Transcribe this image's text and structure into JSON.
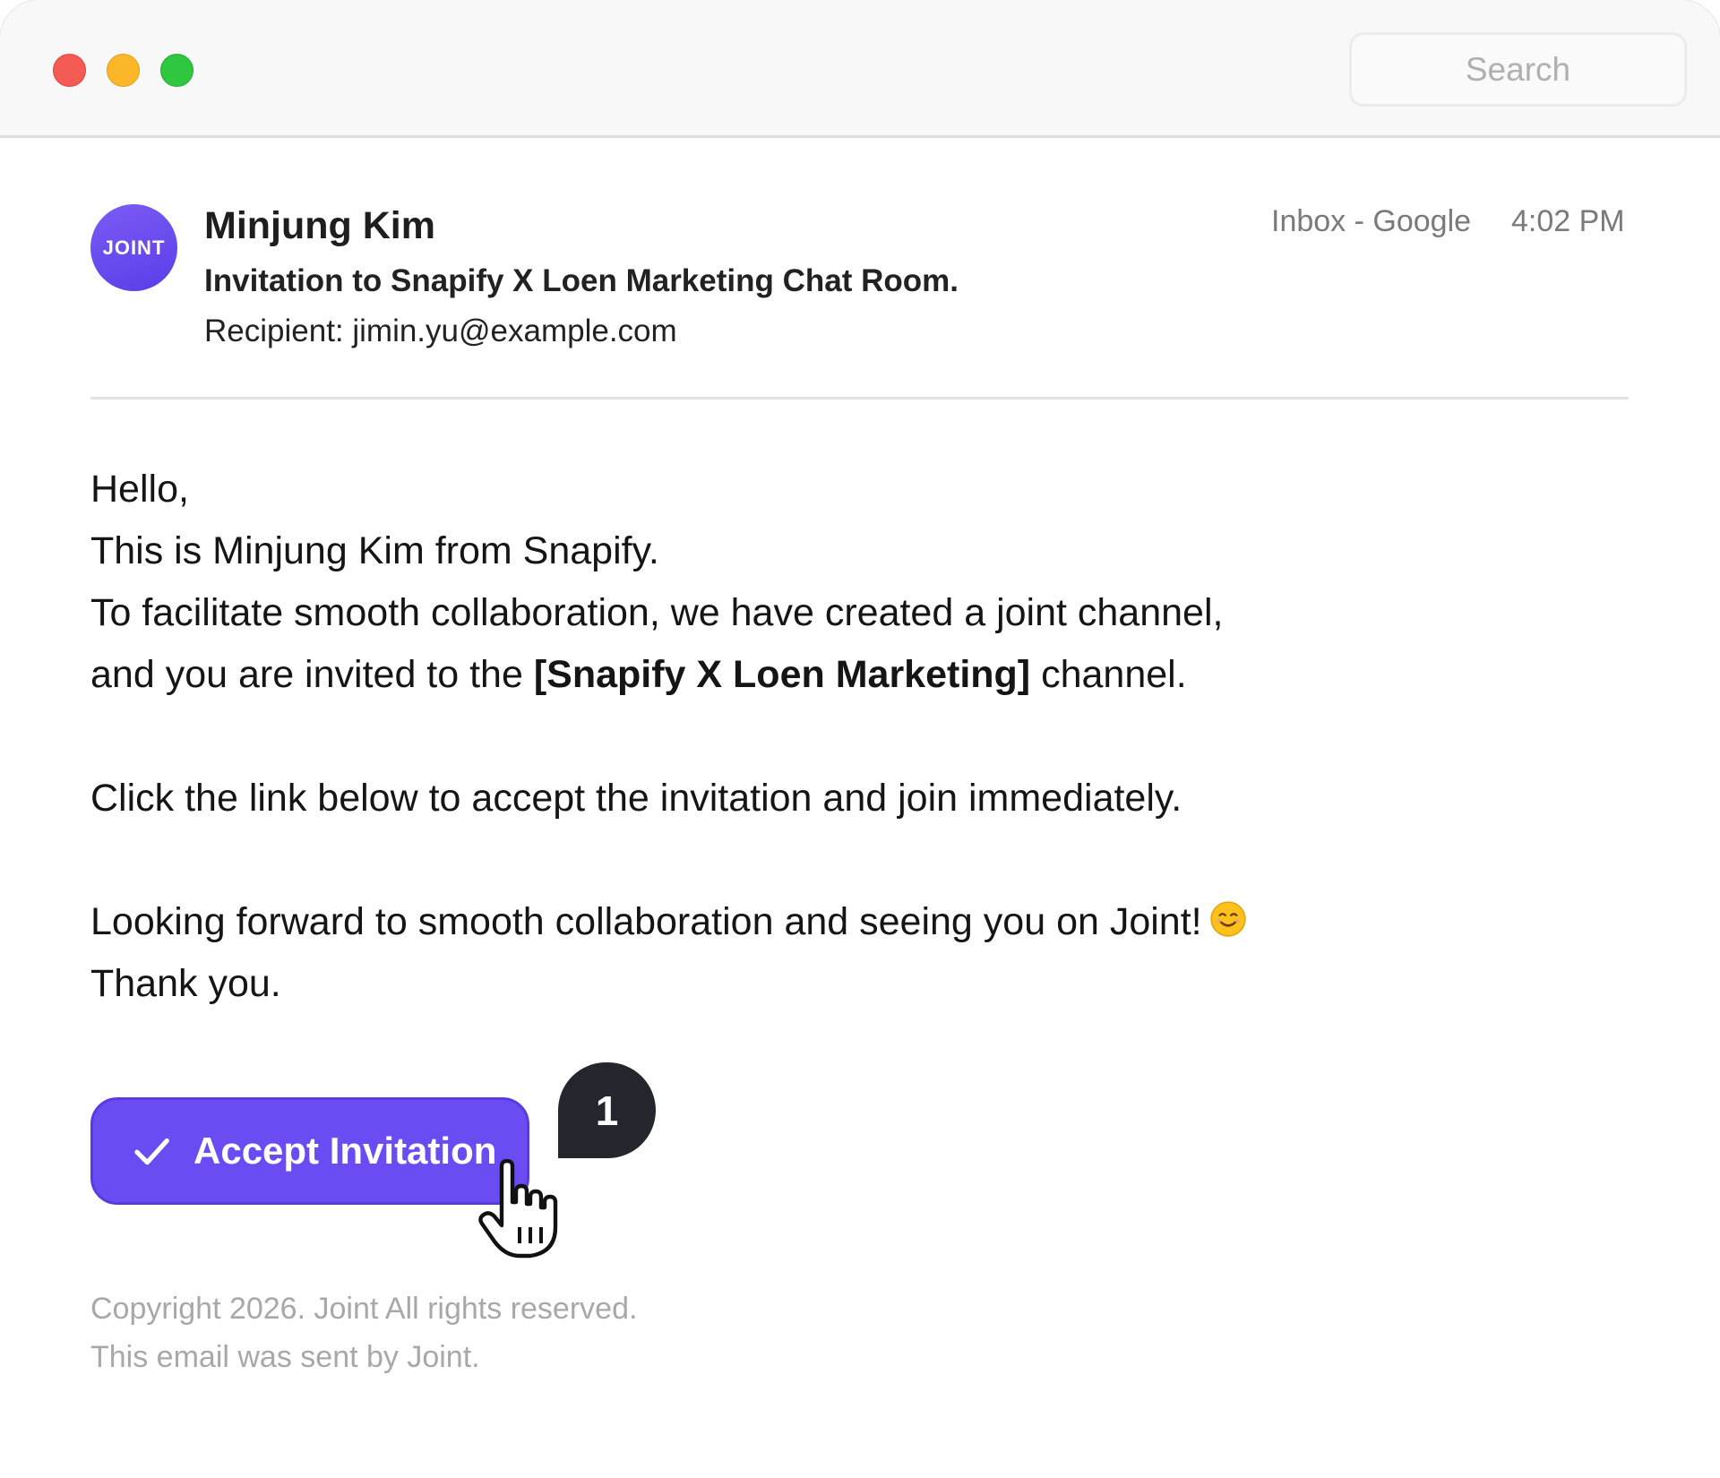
{
  "window": {
    "controls": [
      "close",
      "minimize",
      "zoom"
    ],
    "search": {
      "placeholder": "Search",
      "value": ""
    }
  },
  "email": {
    "avatar_text": "JOINT",
    "sender": "Minjung Kim",
    "subject": "Invitation to Snapify X Loen Marketing Chat Room.",
    "recipient": "Recipient: jimin.yu@example.com",
    "source": "Inbox - Google",
    "time": "4:02 PM",
    "body": {
      "greeting": "Hello,",
      "intro": "This is Minjung Kim from Snapify.",
      "line1": "To facilitate smooth collaboration, we have created a joint channel,",
      "line2_prefix": "and you are invited to the ",
      "line2_channel": "[Snapify X Loen Marketing]",
      "line2_suffix": " channel.",
      "cta_text": "Click the link below to accept the invitation and join immediately.",
      "closing": "Looking forward to smooth collaboration and seeing you on Joint!",
      "closing_emoji": "smiling-face-emoji",
      "thanks": "Thank you."
    },
    "accept_button": {
      "label": "Accept Invitation",
      "icon": "check-icon"
    },
    "step_badge": "1",
    "cursor": "hand-pointer-icon",
    "footer": {
      "copyright": "Copyright 2026. Joint All rights reserved.",
      "sent_by": "This email was sent by Joint."
    }
  },
  "colors": {
    "accent": "#6a4cf2",
    "badge": "#23262d",
    "close": "#f45b54",
    "minimize": "#fbb727",
    "zoom": "#2ec73f"
  }
}
